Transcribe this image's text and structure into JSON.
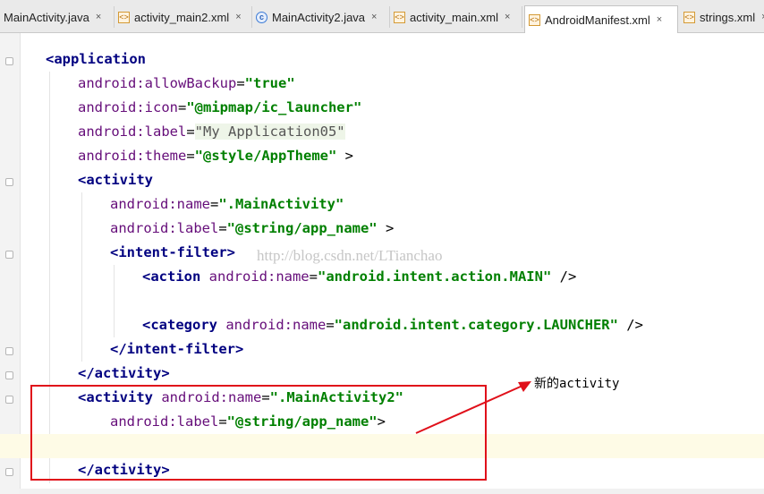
{
  "tabs": [
    {
      "label": "MainActivity.java",
      "icon": "java-class-icon",
      "close": "×"
    },
    {
      "label": "activity_main2.xml",
      "icon": "xml-file-icon",
      "close": "×"
    },
    {
      "label": "MainActivity2.java",
      "icon": "java-class-icon",
      "close": "×"
    },
    {
      "label": "activity_main.xml",
      "icon": "xml-file-icon",
      "close": "×"
    },
    {
      "label": "AndroidManifest.xml",
      "icon": "xml-file-icon",
      "close": "×",
      "active": true
    },
    {
      "label": "strings.xml",
      "icon": "xml-file-icon",
      "close": "×"
    }
  ],
  "code": {
    "l1": {
      "tag": "<application"
    },
    "l2": {
      "attr": "android:allowBackup",
      "eq": "=",
      "val": "\"true\""
    },
    "l3": {
      "attr": "android:icon",
      "eq": "=",
      "val": "\"@mipmap/ic_launcher\""
    },
    "l4": {
      "attr": "android:label",
      "eq": "=",
      "val": "\"My Application05\""
    },
    "l5": {
      "attr": "android:theme",
      "eq": "=",
      "val": "\"@style/AppTheme\"",
      "end": " >"
    },
    "l6": {
      "tag": "<activity"
    },
    "l7": {
      "attr": "android:name",
      "eq": "=",
      "val": "\".MainActivity\""
    },
    "l8": {
      "attr": "android:label",
      "eq": "=",
      "val": "\"@string/app_name\"",
      "end": " >"
    },
    "l9": {
      "tag": "<intent-filter>"
    },
    "l10": {
      "tag": "<action",
      "attr": " android:name",
      "eq": "=",
      "val": "\"android.intent.action.MAIN\"",
      "end": " />"
    },
    "l12": {
      "tag": "<category",
      "attr": " android:name",
      "eq": "=",
      "val": "\"android.intent.category.LAUNCHER\"",
      "end": " />"
    },
    "l13": {
      "tag": "</intent-filter>"
    },
    "l14": {
      "tag": "</activity>"
    },
    "l15": {
      "tag": "<activity",
      "attr": " android:name",
      "eq": "=",
      "val": "\".MainActivity2\""
    },
    "l16": {
      "attr": "android:label",
      "eq": "=",
      "val": "\"@string/app_name\"",
      "end": ">"
    },
    "l18": {
      "tag": "</activity>"
    }
  },
  "watermark": "http://blog.csdn.net/LTianchao",
  "annotation": "新的activity",
  "colors": {
    "highlight_box": "#e0101a",
    "tag": "#000080",
    "attribute": "#660e7a",
    "string": "#008000"
  }
}
